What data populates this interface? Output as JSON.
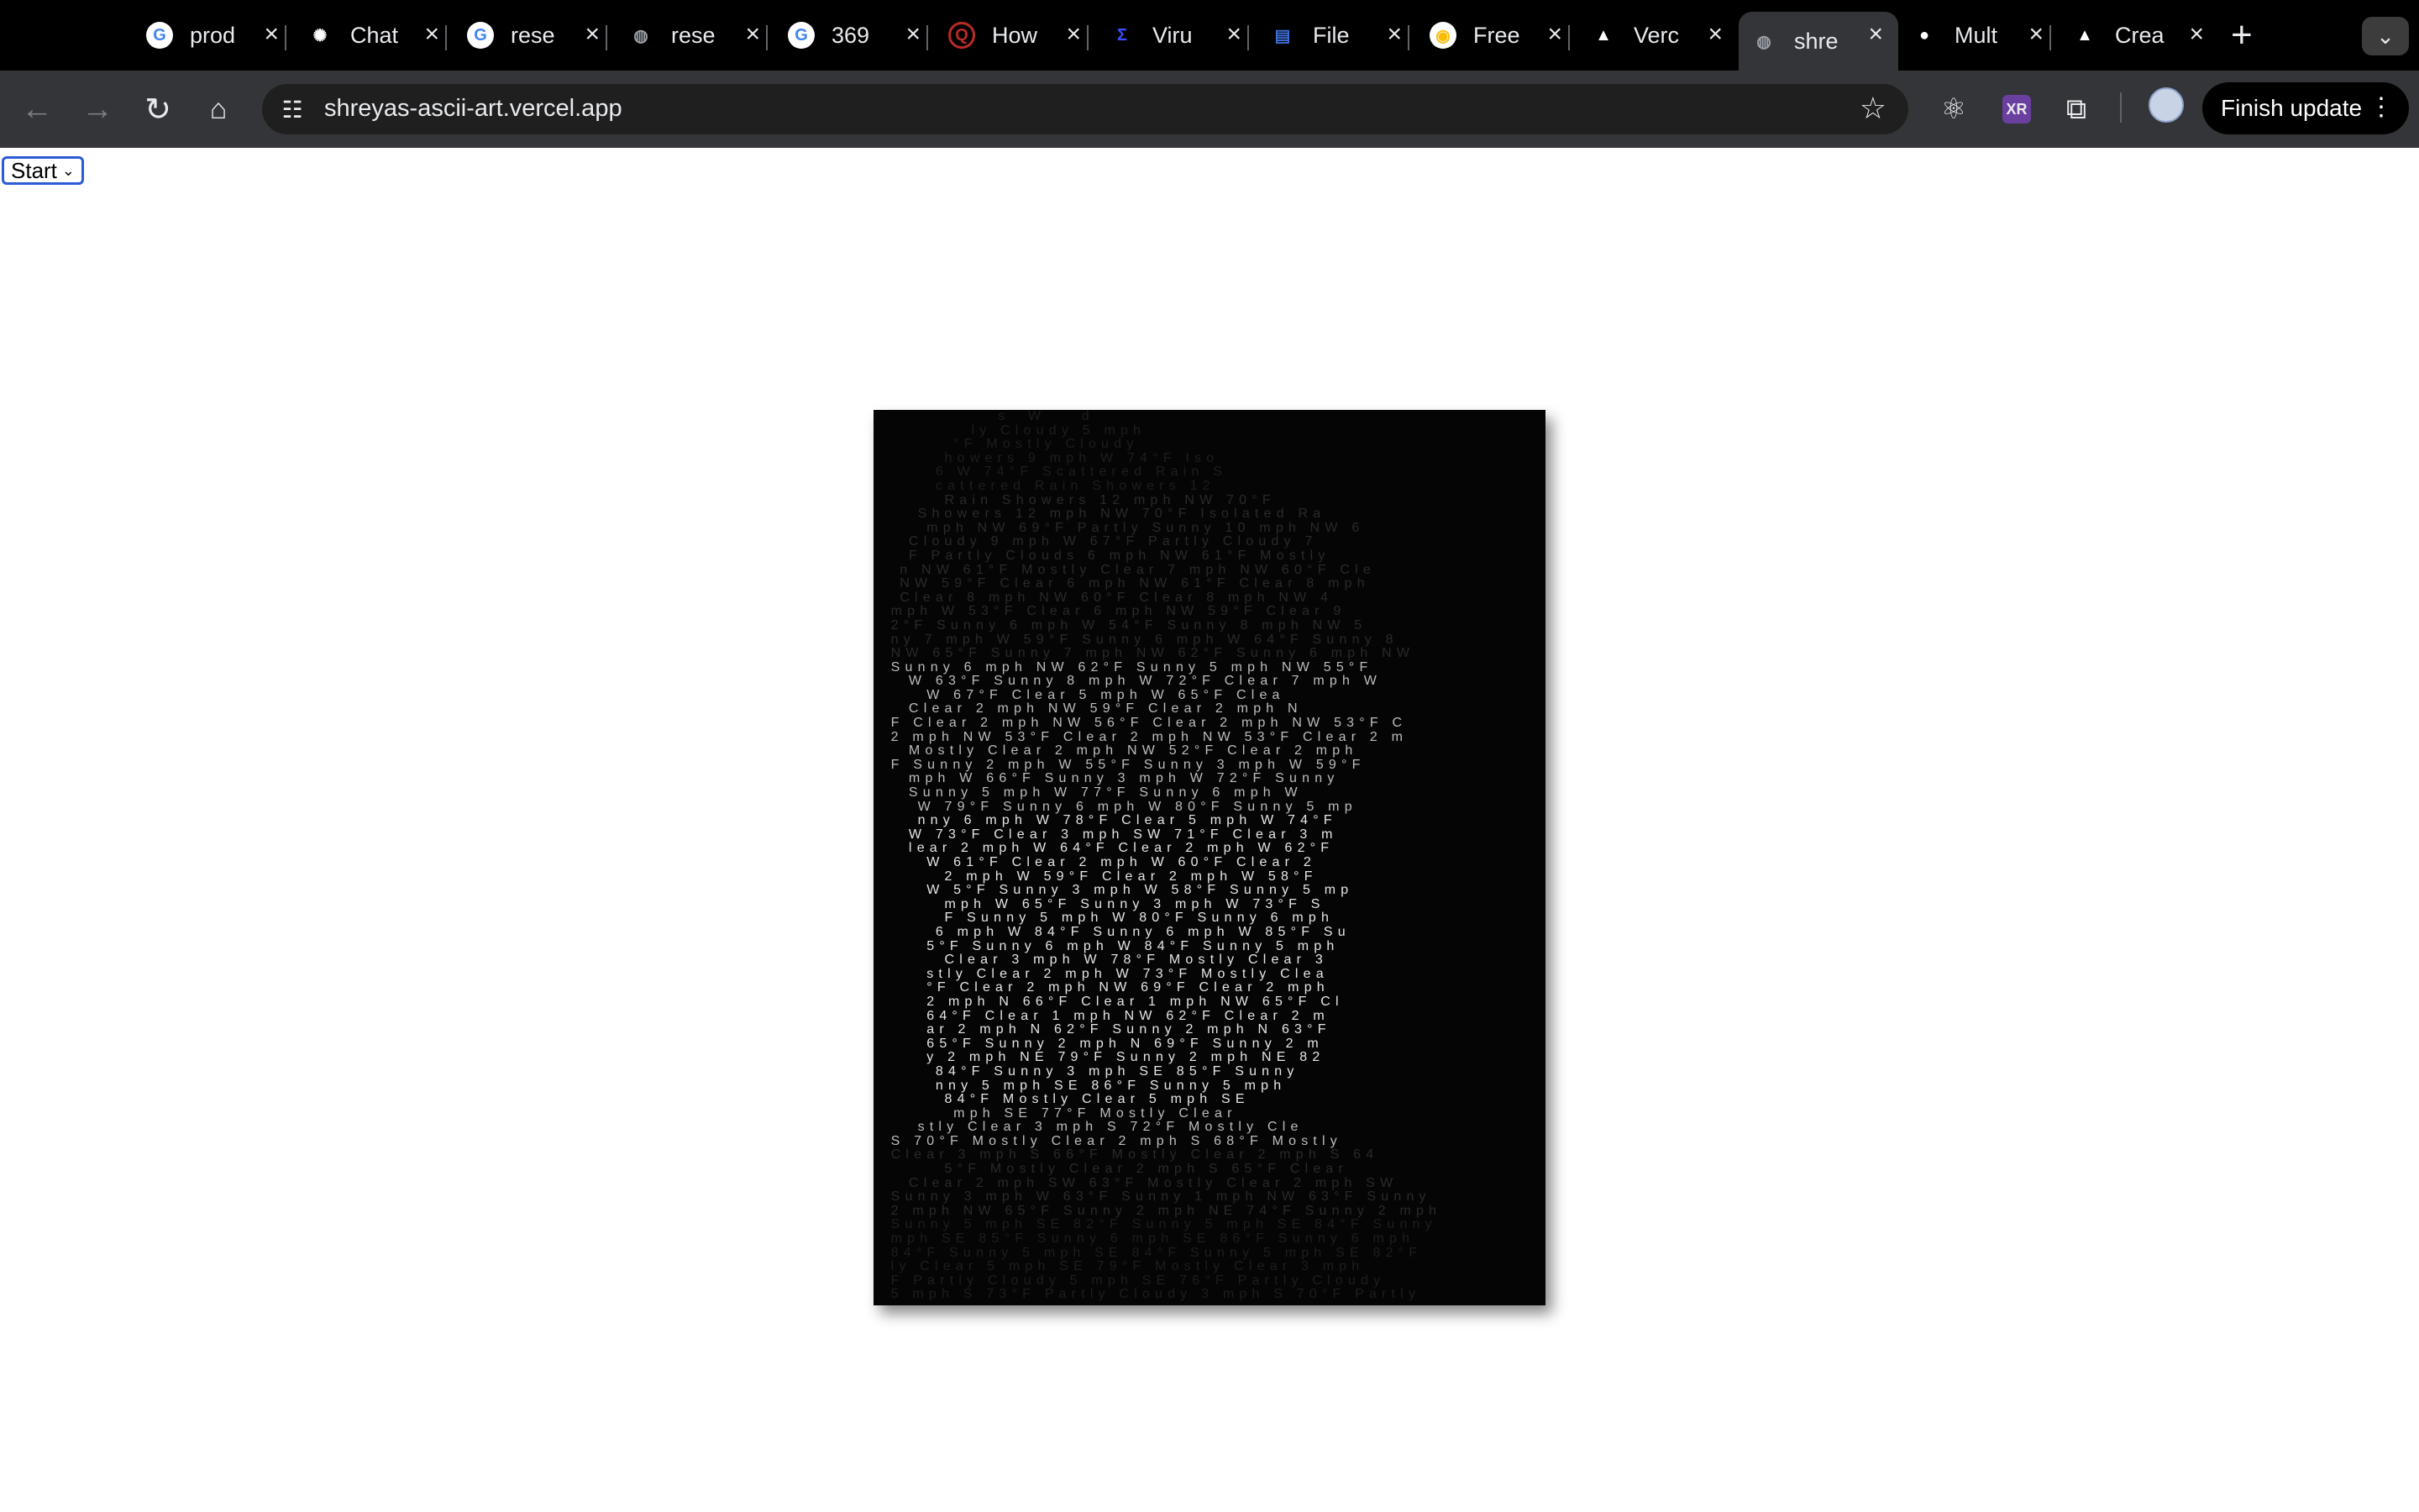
{
  "tabs": [
    {
      "title": "prod",
      "favicon": "google-icon",
      "color": "#4285f4"
    },
    {
      "title": "Chat",
      "favicon": "chatgpt-icon",
      "color": "#ffffff"
    },
    {
      "title": "rese",
      "favicon": "google-icon",
      "color": "#4285f4"
    },
    {
      "title": "rese",
      "favicon": "globe-icon",
      "color": "#9aa0a6"
    },
    {
      "title": "369",
      "favicon": "google-icon",
      "color": "#4285f4"
    },
    {
      "title": "How",
      "favicon": "quora-icon",
      "color": "#b92b27"
    },
    {
      "title": "Viru",
      "favicon": "virustotal-icon",
      "color": "#394eff"
    },
    {
      "title": "File",
      "favicon": "file-icon",
      "color": "#3f6fd8"
    },
    {
      "title": "Free",
      "favicon": "chrome-icon",
      "color": "#fbbc04"
    },
    {
      "title": "Verc",
      "favicon": "vercel-icon",
      "color": "#ffffff"
    },
    {
      "title": "shre",
      "favicon": "globe-icon",
      "color": "#9aa0a6",
      "active": true
    },
    {
      "title": "Mult",
      "favicon": "github-icon",
      "color": "#ffffff"
    },
    {
      "title": "Crea",
      "favicon": "vercel-icon",
      "color": "#ffffff"
    }
  ],
  "address_bar": {
    "url": "shreyas-ascii-art.vercel.app"
  },
  "toolbar": {
    "finish_update_label": "Finish update"
  },
  "page": {
    "select": {
      "value": "Start"
    },
    "ascii_art_lines": [
      "             s  W    d           ",
      "          ly Cloudy 5 mph         ",
      "        °F Mostly Cloudy          ",
      "       howers 9 mph W 74°F Iso    ",
      "      6 W 74°F Scattered Rain S   ",
      "      cattered Rain Showers 12     ",
      "       Rain Showers 12 mph NW 70°F",
      "    Showers 12 mph NW 70°F Isolated Ra",
      "     mph NW 69°F Partly Sunny 10 mph NW 6",
      "   Cloudy 9 mph W 67°F Partly Cloudy 7",
      "   F Partly Clouds 6 mph NW 61°F Mostly",
      "  n NW 61°F Mostly Clear 7 mph NW 60°F Cle",
      "  NW 59°F Clear 6 mph NW 61°F Clear 8 mph",
      "  Clear 8 mph NW 60°F Clear 8 mph NW 4",
      " mph W 53°F Clear 6 mph NW 59°F Clear 9",
      " 2°F Sunny 6 mph W 54°F Sunny 8 mph NW 5",
      " ny 7 mph W 59°F Sunny 6 mph W 64°F Sunny 8",
      " NW 65°F Sunny 7 mph NW 62°F Sunny 6 mph NW",
      " Sunny 6 mph NW 62°F Sunny 5 mph NW 55°F",
      "   W 63°F Sunny 8 mph W 72°F Clear 7 mph W",
      "     W 67°F Clear 5 mph W 65°F Clea",
      "   Clear 2 mph NW 59°F Clear 2 mph N",
      " F Clear 2 mph NW 56°F Clear 2 mph NW 53°F C",
      " 2 mph NW 53°F Clear 2 mph NW 53°F Clear 2 m",
      "   Mostly Clear 2 mph NW 52°F Clear 2 mph",
      " F Sunny 2 mph W 55°F Sunny 3 mph W 59°F",
      "   mph W 66°F Sunny 3 mph W 72°F Sunny",
      "   Sunny 5 mph W 77°F Sunny 6 mph W",
      "    W 79°F Sunny 6 mph W 80°F Sunny 5 mp",
      "    nny 6 mph W 78°F Clear 5 mph W 74°F",
      "   W 73°F Clear 3 mph SW 71°F Clear 3 m",
      "   lear 2 mph W 64°F Clear 2 mph W 62°F",
      "     W 61°F Clear 2 mph W 60°F Clear 2",
      "       2 mph W 59°F Clear 2 mph W 58°F",
      "     W 5°F Sunny 3 mph W 58°F Sunny 5 mp",
      "       mph W 65°F Sunny 3 mph W 73°F S",
      "       F Sunny 5 mph W 80°F Sunny 6 mph",
      "      6 mph W 84°F Sunny 6 mph W 85°F Su",
      "     5°F Sunny 6 mph W 84°F Sunny 5 mph",
      "       Clear 3 mph W 78°F Mostly Clear 3",
      "     stly Clear 2 mph W 73°F Mostly Clea",
      "     °F Clear 2 mph NW 69°F Clear 2 mph",
      "     2 mph N 66°F Clear 1 mph NW 65°F Cl",
      "     64°F Clear 1 mph NW 62°F Clear 2 m",
      "     ar 2 mph N 62°F Sunny 2 mph N 63°F",
      "     65°F Sunny 2 mph N 69°F Sunny 2 m",
      "     y 2 mph NE 79°F Sunny 2 mph NE 82",
      "      84°F Sunny 3 mph SE 85°F Sunny",
      "      nny 5 mph SE 86°F Sunny 5 mph",
      "       84°F Mostly Clear 5 mph SE",
      "        mph SE 77°F Mostly Clear",
      "    stly Clear 3 mph S 72°F Mostly Cle",
      " S 70°F Mostly Clear 2 mph S 68°F Mostly",
      " Clear 3 mph S 66°F Mostly Clear 2 mph S 64",
      "       5°F Mostly Clear 2 mph S 65°F Clear",
      "   Clear 2 mph SW 63°F Mostly Clear 2 mph SW",
      " Sunny 3 mph W 63°F Sunny 1 mph NW 63°F Sunny",
      " 2 mph NW 65°F Sunny 2 mph NE 74°F Sunny 2 mph",
      " Sunny 5 mph SE 82°F Sunny 5 mph SE 84°F Sunny",
      " mph SE 85°F Sunny 6 mph SE 86°F Sunny 6 mph",
      " 84°F Sunny 5 mph SE 84°F Sunny 5 mph SE 82°F",
      " ly Clear 5 mph SE 79°F Mostly Clear 3 mph",
      " F Partly Cloudy 5 mph SE 76°F Partly Cloudy",
      " 5 mph S 73°F Partly Cloudy 3 mph S 70°F Partly"
    ]
  }
}
